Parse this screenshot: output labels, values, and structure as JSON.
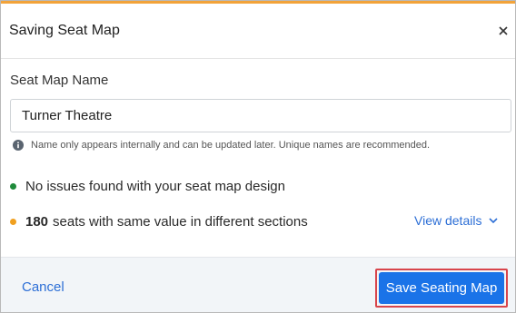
{
  "dialog": {
    "title": "Saving Seat Map",
    "accent_color": "#f2a33a"
  },
  "form": {
    "label": "Seat Map Name",
    "value": "Turner Theatre",
    "hint": "Name only appears internally and can be updated later. Unique names are recommended."
  },
  "checks": {
    "ok": {
      "text": "No issues found with your seat map design",
      "color": "#1e8a3a"
    },
    "warning": {
      "count": "180",
      "text": "seats with same value in different sections",
      "color": "#f0a020",
      "link": "View details"
    }
  },
  "footer": {
    "cancel": "Cancel",
    "save": "Save Seating Map",
    "save_color": "#1a73e8",
    "highlight_color": "#d8454c"
  }
}
